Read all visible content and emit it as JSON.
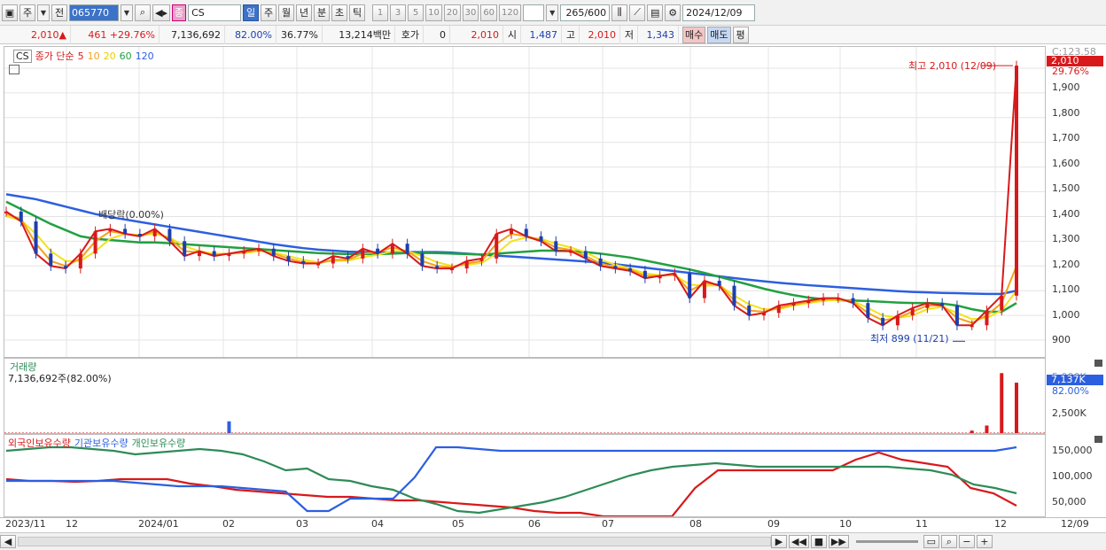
{
  "toolbar": {
    "unit": "주",
    "prev": "전",
    "code": "065770",
    "type_icon": "종",
    "name": "CS",
    "periods": [
      "일",
      "주",
      "월",
      "년",
      "분",
      "초",
      "틱"
    ],
    "selected_period": "일",
    "intervals": [
      "1",
      "3",
      "5",
      "10",
      "20",
      "30",
      "60",
      "120"
    ],
    "count": "265",
    "count_max": "/600",
    "date": "2024/12/09"
  },
  "quote": {
    "price": "2,010",
    "change": "461",
    "change_pct": "+29.76%",
    "volume": "7,136,692",
    "vol_ratio": "82.00%",
    "turnover": "36.77%",
    "amount": "13,214백만",
    "hoga_label": "호가",
    "hoga": "0",
    "hoga_price": "2,010",
    "open_label": "시",
    "open": "1,487",
    "high_label": "고",
    "high": "2,010",
    "low_label": "저",
    "low": "1,343",
    "buy": "매수",
    "sell": "매도",
    "avg": "평"
  },
  "price_pane": {
    "legend_name": "CS",
    "legend_title": "종가 단순",
    "ma": [
      {
        "label": "5",
        "color": "#d8191b"
      },
      {
        "label": "10",
        "color": "#f3a21a"
      },
      {
        "label": "20",
        "color": "#f3e21a"
      },
      {
        "label": "60",
        "color": "#22a040"
      },
      {
        "label": "120",
        "color": "#2c5fe0"
      }
    ],
    "y_labels": [
      "1,900",
      "1,800",
      "1,700",
      "1,600",
      "1,500",
      "1,400",
      "1,300",
      "1,200",
      "1,100",
      "1,000",
      "900"
    ],
    "top_note": "C:123.58",
    "last_tag": "2,010",
    "last_pct": "29.76%",
    "high_note": "최고 2,010 (12/09)",
    "low_note": "최저 899 (11/21)",
    "event": "배당락(0.00%)"
  },
  "volume_pane": {
    "title": "거래량",
    "value": "7,136,692주(82.00%)",
    "y_labels": [
      "2,500K"
    ],
    "tag": "7,137K",
    "tag2": "82.00%",
    "faded": "5,000K"
  },
  "holder_pane": {
    "title1": "외국인보유수량",
    "title2": "기관보유수량",
    "title3": "개인보유수량",
    "y_labels": [
      "150,000",
      "100,000",
      "50,000"
    ],
    "colors": {
      "foreign": "#d8191b",
      "inst": "#2c5fe0",
      "indiv": "#2e8b57"
    }
  },
  "x_labels": [
    "2023/11",
    "12",
    "2024/01",
    "02",
    "03",
    "04",
    "05",
    "06",
    "07",
    "08",
    "09",
    "10",
    "11",
    "12",
    "12/09"
  ],
  "chart_data": {
    "type": "line",
    "title": "CS",
    "dates_start": "2023/11",
    "dates_end": "2024/12/09",
    "series": [
      {
        "name": "5",
        "values": [
          1420,
          1380,
          1250,
          1200,
          1190,
          1250,
          1340,
          1350,
          1330,
          1320,
          1350,
          1300,
          1240,
          1260,
          1240,
          1250,
          1260,
          1270,
          1240,
          1220,
          1210,
          1210,
          1240,
          1230,
          1270,
          1250,
          1290,
          1250,
          1200,
          1190,
          1190,
          1220,
          1230,
          1330,
          1350,
          1320,
          1300,
          1260,
          1260,
          1230,
          1200,
          1190,
          1180,
          1150,
          1160,
          1170,
          1070,
          1140,
          1120,
          1040,
          1000,
          1010,
          1040,
          1050,
          1060,
          1070,
          1070,
          1050,
          990,
          960,
          1000,
          1030,
          1050,
          1040,
          960,
          960,
          1020,
          1080,
          2010
        ]
      },
      {
        "name": "10",
        "values": [
          1410,
          1390,
          1290,
          1220,
          1200,
          1230,
          1300,
          1340,
          1330,
          1320,
          1340,
          1310,
          1260,
          1255,
          1245,
          1250,
          1255,
          1265,
          1250,
          1230,
          1215,
          1210,
          1225,
          1225,
          1250,
          1255,
          1275,
          1260,
          1220,
          1200,
          1195,
          1210,
          1220,
          1290,
          1330,
          1320,
          1305,
          1275,
          1265,
          1240,
          1210,
          1195,
          1185,
          1160,
          1160,
          1165,
          1100,
          1130,
          1125,
          1060,
          1020,
          1015,
          1030,
          1045,
          1055,
          1065,
          1068,
          1055,
          1010,
          980,
          990,
          1015,
          1040,
          1040,
          990,
          970,
          1000,
          1050,
          1200
        ]
      },
      {
        "name": "20",
        "values": [
          1400,
          1385,
          1330,
          1260,
          1220,
          1220,
          1260,
          1310,
          1330,
          1325,
          1330,
          1315,
          1280,
          1260,
          1250,
          1250,
          1252,
          1260,
          1255,
          1240,
          1225,
          1215,
          1220,
          1222,
          1235,
          1245,
          1260,
          1260,
          1240,
          1215,
          1200,
          1205,
          1212,
          1250,
          1300,
          1315,
          1310,
          1290,
          1275,
          1255,
          1225,
          1205,
          1190,
          1170,
          1162,
          1162,
          1125,
          1120,
          1122,
          1080,
          1045,
          1025,
          1025,
          1040,
          1050,
          1058,
          1063,
          1058,
          1030,
          1000,
          990,
          1000,
          1025,
          1035,
          1010,
          985,
          990,
          1020,
          1100
        ]
      },
      {
        "name": "60",
        "values": [
          1460,
          1430,
          1400,
          1370,
          1345,
          1320,
          1310,
          1305,
          1300,
          1295,
          1295,
          1292,
          1288,
          1284,
          1280,
          1276,
          1272,
          1268,
          1264,
          1260,
          1256,
          1252,
          1250,
          1248,
          1248,
          1248,
          1250,
          1252,
          1253,
          1252,
          1250,
          1248,
          1246,
          1250,
          1254,
          1258,
          1262,
          1262,
          1260,
          1256,
          1250,
          1242,
          1234,
          1222,
          1210,
          1198,
          1186,
          1172,
          1156,
          1140,
          1124,
          1108,
          1094,
          1082,
          1072,
          1066,
          1062,
          1060,
          1058,
          1055,
          1052,
          1050,
          1050,
          1048,
          1040,
          1025,
          1015,
          1015,
          1050
        ]
      },
      {
        "name": "120",
        "values": [
          1490,
          1480,
          1470,
          1455,
          1440,
          1425,
          1410,
          1398,
          1388,
          1378,
          1368,
          1358,
          1348,
          1338,
          1328,
          1318,
          1308,
          1298,
          1288,
          1280,
          1272,
          1266,
          1262,
          1258,
          1256,
          1255,
          1255,
          1256,
          1256,
          1256,
          1254,
          1250,
          1246,
          1242,
          1238,
          1234,
          1230,
          1226,
          1222,
          1218,
          1213,
          1207,
          1200,
          1193,
          1186,
          1179,
          1172,
          1165,
          1158,
          1151,
          1144,
          1138,
          1132,
          1127,
          1122,
          1118,
          1114,
          1110,
          1106,
          1102,
          1098,
          1095,
          1093,
          1091,
          1090,
          1088,
          1087,
          1087,
          1100
        ]
      }
    ],
    "volume": [
      0,
      0,
      0,
      0,
      0,
      0,
      0,
      0,
      0,
      0,
      0,
      0,
      0,
      0,
      0,
      1400,
      0,
      0,
      0,
      0,
      0,
      0,
      0,
      0,
      0,
      0,
      0,
      0,
      0,
      0,
      0,
      0,
      0,
      0,
      0,
      0,
      0,
      0,
      0,
      0,
      0,
      0,
      0,
      0,
      0,
      0,
      0,
      0,
      0,
      0,
      0,
      0,
      0,
      0,
      0,
      0,
      0,
      0,
      0,
      0,
      0,
      0,
      0,
      0,
      0,
      300,
      900,
      7137,
      6000
    ],
    "ylim": [
      850,
      2050
    ],
    "grid": true
  }
}
